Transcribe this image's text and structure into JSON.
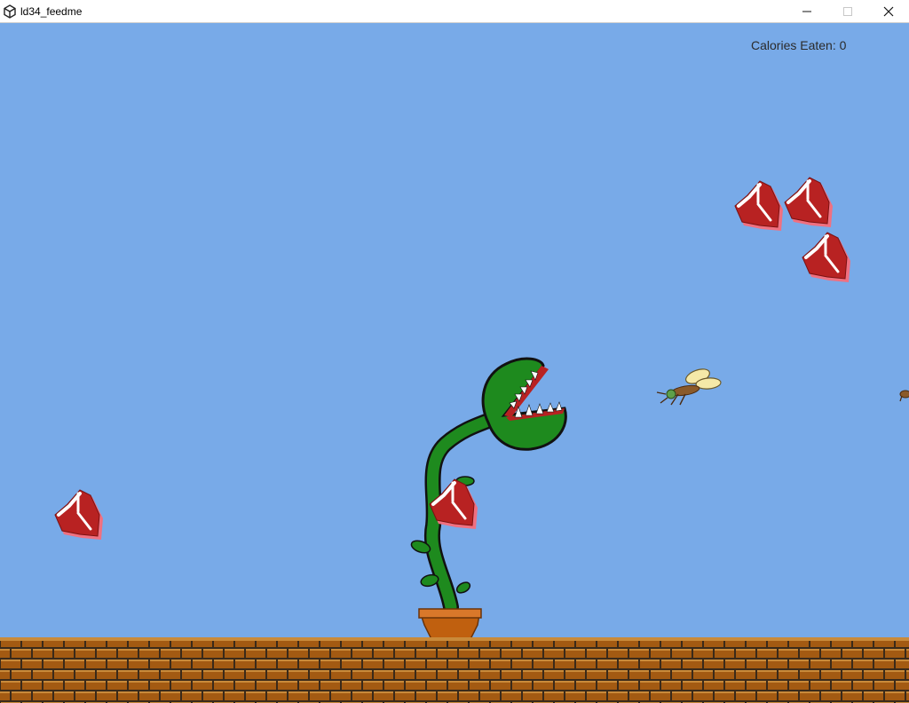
{
  "window": {
    "title": "ld34_feedme",
    "app_icon": "unity-icon",
    "controls": [
      "minimize-icon",
      "maximize-icon",
      "close-icon"
    ]
  },
  "hud": {
    "calories_label": "Calories Eaten: 0"
  },
  "scene": {
    "sky_color": "#78aae8",
    "brick_color": "#a35a12",
    "mortar_color": "#3a2a1a",
    "plant_color": "#1e8a1e",
    "pot_color": "#c0600f",
    "steak_color": "#b82222",
    "steak_count": 5,
    "fly_count": 1
  }
}
